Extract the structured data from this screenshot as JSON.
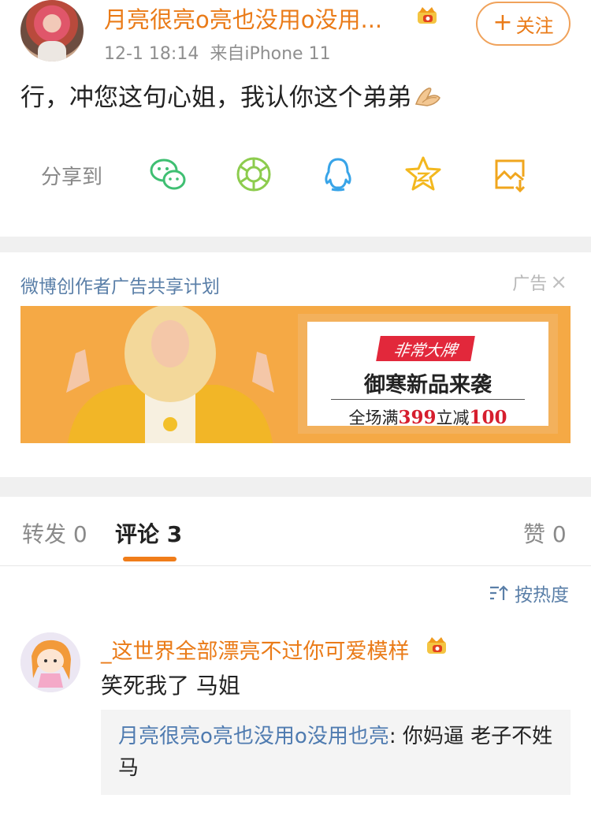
{
  "post": {
    "username": "月亮很亮o亮也没用o没用...",
    "timestamp": "12-1 18:14",
    "source": "来自iPhone 11",
    "follow_label": "关注",
    "text": "行，冲您这句心姐，我认你这个弟弟",
    "share_label": "分享到",
    "share_targets": [
      "wechat-icon",
      "moments-icon",
      "qq-icon",
      "qzone-icon",
      "save-image-icon"
    ]
  },
  "ad": {
    "title": "微博创作者广告共享计划",
    "tag": "广告",
    "badge": "非常大牌",
    "headline": "御寒新品来袭",
    "promo_prefix": "全场满",
    "promo_threshold": "399",
    "promo_middle": "立减",
    "promo_discount": "100"
  },
  "tabs": {
    "repost_label": "转发",
    "repost_count": "0",
    "comment_label": "评论",
    "comment_count": "3",
    "like_label": "赞",
    "like_count": "0"
  },
  "sort": {
    "label": "按热度"
  },
  "comment": {
    "username": "_这世界全部漂亮不过你可爱模样",
    "text": "笑死我了 马姐",
    "reply_name": "月亮很亮o亮也没用o没用也亮",
    "reply_text": ": 你妈逼 老子不姓马"
  },
  "colors": {
    "accent_orange": "#ea7b18",
    "link_blue": "#4f7bb0",
    "ad_red": "#d61e2e"
  }
}
